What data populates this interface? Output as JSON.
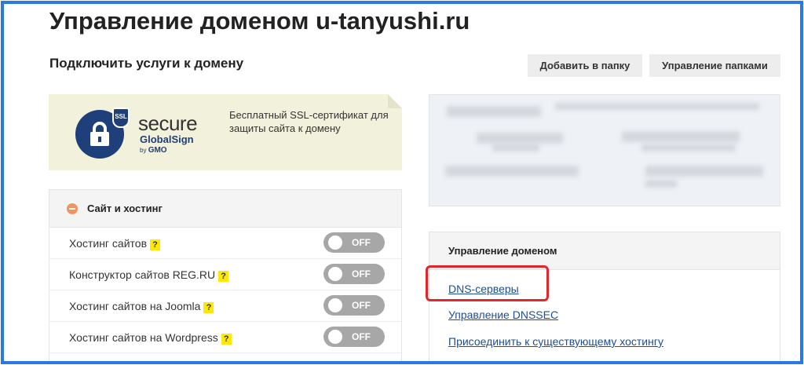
{
  "header": {
    "title": "Управление доменом u-tanyushi.ru",
    "subtitle": "Подключить услуги к домену"
  },
  "toolbar": {
    "add_to_folder": "Добавить в папку",
    "manage_folders": "Управление папками"
  },
  "ssl_banner": {
    "logo_secure": "secure",
    "logo_globalsign": "GlobalSign",
    "logo_by": "by",
    "logo_gmo": "GMO",
    "logo_badge": "SSL",
    "text": "Бесплатный SSL-сертификат для защиты сайта к домену"
  },
  "hosting_panel": {
    "title": "Сайт и хостинг",
    "icon": "minus-icon",
    "rows": [
      {
        "label": "Хостинг сайтов",
        "help": "?",
        "toggle": "OFF"
      },
      {
        "label": "Конструктор сайтов REG.RU",
        "help": "?",
        "toggle": "OFF"
      },
      {
        "label": "Хостинг сайтов на Joomla",
        "help": "?",
        "toggle": "OFF"
      },
      {
        "label": "Хостинг сайтов на Wordpress",
        "help": "?",
        "toggle": "OFF"
      }
    ]
  },
  "domain_panel": {
    "title": "Управление доменом",
    "links": [
      {
        "label": "DNS-серверы"
      },
      {
        "label": "Управление DNSSEC"
      },
      {
        "label": "Присоединить к существующему хостингу"
      }
    ]
  },
  "colors": {
    "frame": "#2b78e4",
    "highlight": "#e0282c",
    "link": "#1b4f94",
    "help_badge": "#ffe900",
    "toggle_off": "#a7a7a7",
    "minus_icon": "#f29362"
  }
}
